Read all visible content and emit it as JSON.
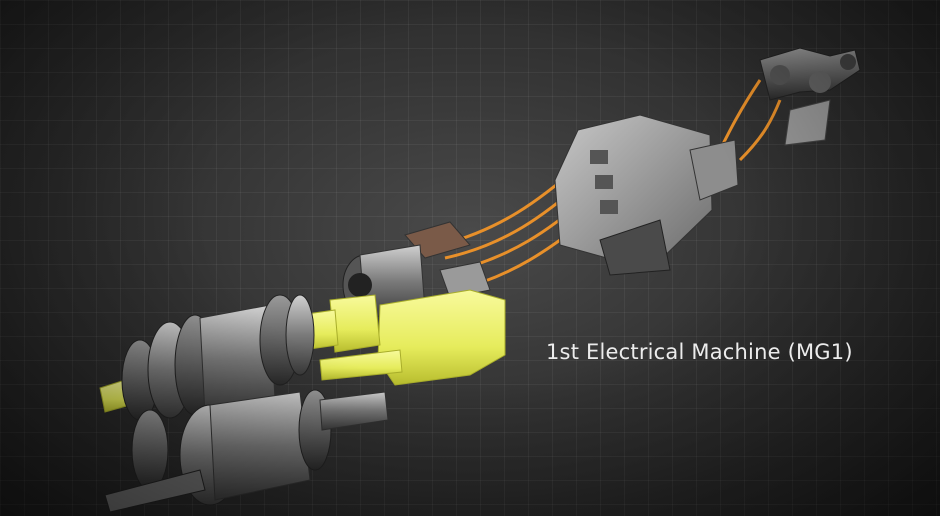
{
  "caption": "1st Electrical Machine (MG1)",
  "colors": {
    "highlight": "#e8ee6a",
    "cable": "#e8902a",
    "metal": "#8a8a8a"
  }
}
